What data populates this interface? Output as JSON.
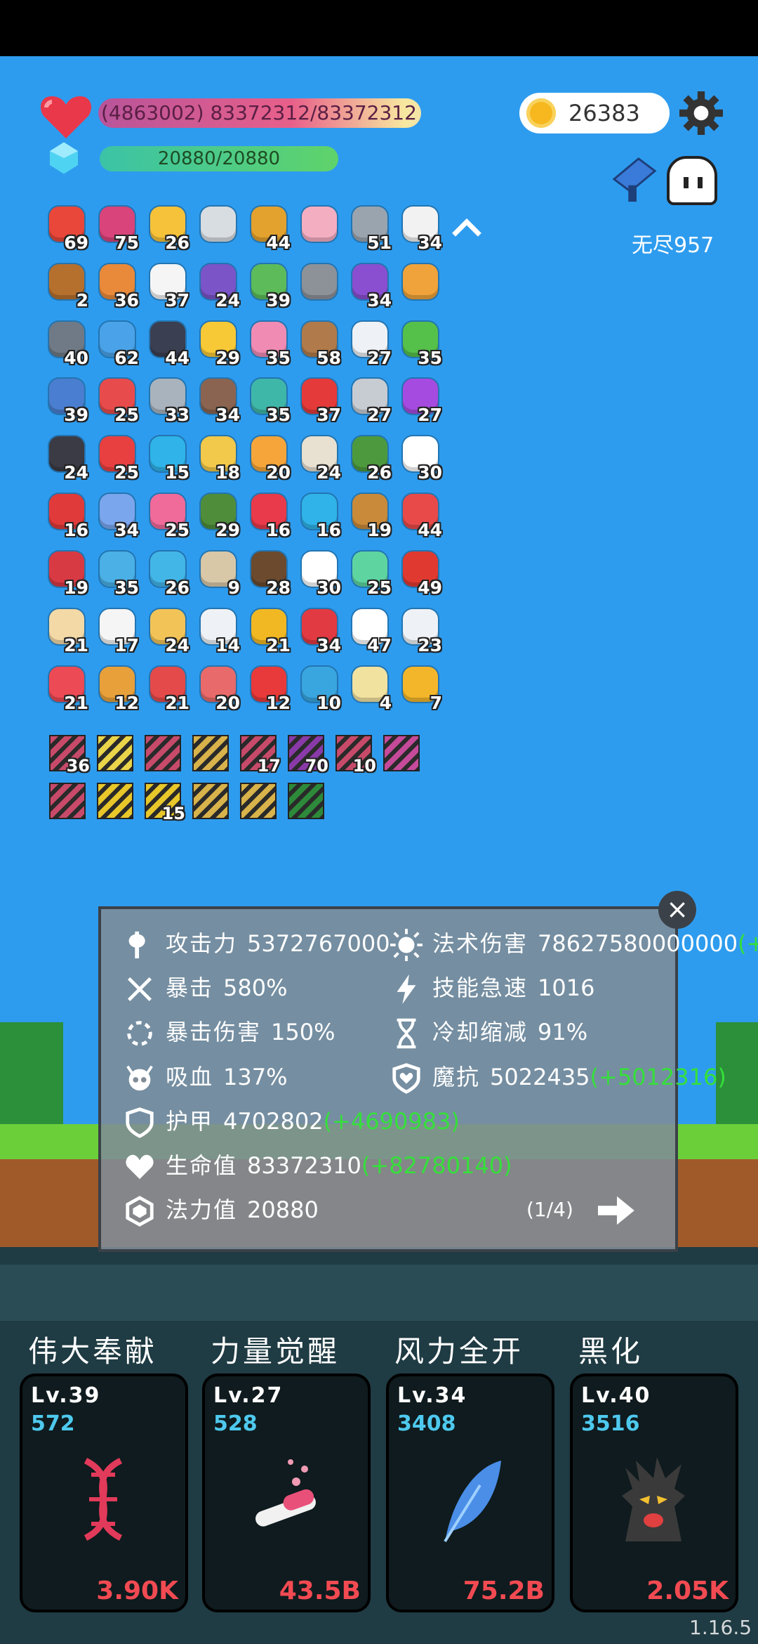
{
  "hud": {
    "hp_text": "(4863002) 83372312/83372312",
    "hp_fill_fraction": 1.0,
    "mp_text": "20880/20880",
    "mp_fill_fraction": 1.0,
    "coins": "26383",
    "mode_label": "无尽957"
  },
  "inventory": {
    "rows": [
      [
        {
          "icon": "watermelon-icon",
          "count": "69",
          "color": "#e8473a"
        },
        {
          "icon": "jam-jar-icon",
          "count": "75",
          "color": "#d9447a"
        },
        {
          "icon": "sun-icon",
          "count": "26",
          "color": "#f6c23a"
        },
        {
          "icon": "sword-icon",
          "count": "",
          "color": "#d8dde2"
        },
        {
          "icon": "book-icon",
          "count": "44",
          "color": "#e3a12e"
        },
        {
          "icon": "love-letter-icon",
          "count": "",
          "color": "#f4aec2"
        },
        {
          "icon": "broadsword-icon",
          "count": "51",
          "color": "#9aa4ae"
        },
        {
          "icon": "dice-icon",
          "count": "34",
          "color": "#f2f2f2"
        }
      ],
      [
        {
          "icon": "drumstick-icon",
          "count": "2",
          "color": "#b5702e"
        },
        {
          "icon": "meteor-icon",
          "count": "36",
          "color": "#e98a3a"
        },
        {
          "icon": "playing-cards-icon",
          "count": "37",
          "color": "#f5f5f5"
        },
        {
          "icon": "star-shield-icon",
          "count": "24",
          "color": "#7b54c8"
        },
        {
          "icon": "money-heart-icon",
          "count": "39",
          "color": "#5dbb5a"
        },
        {
          "icon": "knight-helmet-icon",
          "count": "",
          "color": "#8d9299"
        },
        {
          "icon": "purple-hat-icon",
          "count": "34",
          "color": "#8a4fd0"
        },
        {
          "icon": "ticket-icon",
          "count": "",
          "color": "#f0a33a"
        }
      ],
      [
        {
          "icon": "spiked-ball-icon",
          "count": "40",
          "color": "#6f7a86"
        },
        {
          "icon": "star-card-icon",
          "count": "62",
          "color": "#4aa3e8"
        },
        {
          "icon": "bat-icon",
          "count": "44",
          "color": "#3b3f52"
        },
        {
          "icon": "crown-icon",
          "count": "29",
          "color": "#f7c936"
        },
        {
          "icon": "ice-cream-icon",
          "count": "35",
          "color": "#f08cb4"
        },
        {
          "icon": "donut-shield-icon",
          "count": "58",
          "color": "#b07a4a"
        },
        {
          "icon": "cloud-icon",
          "count": "27",
          "color": "#eef2f6"
        },
        {
          "icon": "green-slime-icon",
          "count": "35",
          "color": "#55c04a"
        }
      ],
      [
        {
          "icon": "blue-shield-icon",
          "count": "39",
          "color": "#4a7ed0"
        },
        {
          "icon": "pill-icon",
          "count": "25",
          "color": "#e84b4b"
        },
        {
          "icon": "battle-axe-icon",
          "count": "33",
          "color": "#a9b3bd"
        },
        {
          "icon": "helmet-icon",
          "count": "34",
          "color": "#8a6450"
        },
        {
          "icon": "ring-target-icon",
          "count": "35",
          "color": "#3fb7a8"
        },
        {
          "icon": "mushroom-icon",
          "count": "37",
          "color": "#e53a3a"
        },
        {
          "icon": "compass-icon",
          "count": "27",
          "color": "#c7ccd2"
        },
        {
          "icon": "magic-orb-icon",
          "count": "27",
          "color": "#a64be0"
        }
      ],
      [
        {
          "icon": "cauldron-icon",
          "count": "24",
          "color": "#3b3b45"
        },
        {
          "icon": "gift-box-icon",
          "count": "25",
          "color": "#e84040"
        },
        {
          "icon": "blue-gem-icon",
          "count": "15",
          "color": "#2fb3e8"
        },
        {
          "icon": "diamond-ring-icon",
          "count": "18",
          "color": "#f2c94a"
        },
        {
          "icon": "magic-wand-icon",
          "count": "20",
          "color": "#f6a53a"
        },
        {
          "icon": "flag-cake-icon",
          "count": "24",
          "color": "#e8e0d0"
        },
        {
          "icon": "green-helmet-icon",
          "count": "26",
          "color": "#4d9a3e"
        },
        {
          "icon": "ghost-icon",
          "count": "30",
          "color": "#ffffff"
        }
      ],
      [
        {
          "icon": "rose-icon",
          "count": "16",
          "color": "#e03a3a"
        },
        {
          "icon": "capsule-icon",
          "count": "34",
          "color": "#7aa6ee"
        },
        {
          "icon": "potion-bottle-icon",
          "count": "25",
          "color": "#f06a9a"
        },
        {
          "icon": "grenade-icon",
          "count": "29",
          "color": "#4f8d3a"
        },
        {
          "icon": "broken-heart-icon",
          "count": "16",
          "color": "#e83a4a"
        },
        {
          "icon": "crosshair-icon",
          "count": "16",
          "color": "#2fb3e8"
        },
        {
          "icon": "bow-icon",
          "count": "19",
          "color": "#c98a3a"
        },
        {
          "icon": "sock-icon",
          "count": "44",
          "color": "#e84a4a"
        }
      ],
      [
        {
          "icon": "red-shield-icon",
          "count": "19",
          "color": "#d83a44"
        },
        {
          "icon": "blue-bomb-icon",
          "count": "35",
          "color": "#4ab0e6"
        },
        {
          "icon": "chat-bubble-icon",
          "count": "26",
          "color": "#43b6e8"
        },
        {
          "icon": "noose-icon",
          "count": "9",
          "color": "#d8c8a8"
        },
        {
          "icon": "coconut-icon",
          "count": "28",
          "color": "#6b4a2e"
        },
        {
          "icon": "fried-egg-icon",
          "count": "30",
          "color": "#ffffff"
        },
        {
          "icon": "green-spirit-icon",
          "count": "25",
          "color": "#5ed5a0"
        },
        {
          "icon": "apple-icon",
          "count": "49",
          "color": "#e03a30"
        }
      ],
      [
        {
          "icon": "hand-icon",
          "count": "21",
          "color": "#f3d9a6"
        },
        {
          "icon": "clipboard-icon",
          "count": "17",
          "color": "#f5f5f5"
        },
        {
          "icon": "folded-map-icon",
          "count": "24",
          "color": "#f2c458"
        },
        {
          "icon": "light-bulb-icon",
          "count": "14",
          "color": "#eef2f6"
        },
        {
          "icon": "sunflower-icon",
          "count": "21",
          "color": "#f2b824"
        },
        {
          "icon": "strawberry-icon",
          "count": "34",
          "color": "#e23a42"
        },
        {
          "icon": "daisy-icon",
          "count": "47",
          "color": "#ffffff"
        },
        {
          "icon": "envelope-icon",
          "count": "23",
          "color": "#eef2f6"
        }
      ],
      [
        {
          "icon": "heart-icon",
          "count": "21",
          "color": "#ec4a55"
        },
        {
          "icon": "scroll-icon",
          "count": "12",
          "color": "#e8a03a"
        },
        {
          "icon": "thermometer-icon",
          "count": "21",
          "color": "#e44a4a"
        },
        {
          "icon": "meat-icon",
          "count": "20",
          "color": "#e86a6a"
        },
        {
          "icon": "bookmark-icon",
          "count": "12",
          "color": "#e83a3a"
        },
        {
          "icon": "blue-scroll-icon",
          "count": "10",
          "color": "#3aa6e0"
        },
        {
          "icon": "halo-icon",
          "count": "4",
          "color": "#f2e2a0"
        },
        {
          "icon": "coin-stack-icon",
          "count": "7",
          "color": "#f3b62a"
        }
      ]
    ],
    "equipment": [
      [
        {
          "icon": "striped-card-icon",
          "count": "36",
          "color": "#c84a6a"
        },
        {
          "icon": "glow-card-icon",
          "count": "",
          "color": "#e9d44a"
        },
        {
          "icon": "striped-card-icon",
          "count": "",
          "color": "#c84a6a"
        },
        {
          "icon": "gold-box-icon",
          "count": "",
          "color": "#d8b24a"
        },
        {
          "icon": "striped-card-icon",
          "count": "17",
          "color": "#c84a6a"
        },
        {
          "icon": "purple-rune-icon",
          "count": "70",
          "color": "#8a3aa8"
        },
        {
          "icon": "striped-card-icon",
          "count": "10",
          "color": "#c84a6a"
        },
        {
          "icon": "pink-rune-icon",
          "count": "",
          "color": "#c64a9a"
        }
      ],
      [
        {
          "icon": "striped-card-icon",
          "count": "",
          "color": "#c84a6a"
        },
        {
          "icon": "yellow-face-icon",
          "count": "",
          "color": "#e8c72a"
        },
        {
          "icon": "yellow-face-icon",
          "count": "15",
          "color": "#e8c72a"
        },
        {
          "icon": "gold-box-icon",
          "count": "",
          "color": "#d8b24a"
        },
        {
          "icon": "gold-box-icon",
          "count": "",
          "color": "#d8b24a"
        },
        {
          "icon": "green-rune-icon",
          "count": "",
          "color": "#2d8a3a"
        }
      ]
    ]
  },
  "stats": {
    "left": [
      {
        "icon": "axe-icon",
        "name": "攻击力",
        "value": "5372767000",
        "bonus": ""
      },
      {
        "icon": "crit-icon",
        "name": "暴击",
        "value": "580%",
        "bonus": ""
      },
      {
        "icon": "crit-damage-icon",
        "name": "暴击伤害",
        "value": "150%",
        "bonus": ""
      },
      {
        "icon": "skull-icon",
        "name": "吸血",
        "value": "137%",
        "bonus": ""
      },
      {
        "icon": "armor-shield-icon",
        "name": "护甲",
        "value": "4702802",
        "bonus": "(+4690983)"
      },
      {
        "icon": "heart-icon",
        "name": "生命值",
        "value": "83372310",
        "bonus": "(+82780140)"
      },
      {
        "icon": "mana-crystal-icon",
        "name": "法力值",
        "value": "20880",
        "bonus": ""
      }
    ],
    "right": [
      {
        "icon": "sun-icon",
        "name": "法术伤害",
        "value": "78627580000000",
        "bonus": "(+"
      },
      {
        "icon": "lightning-icon",
        "name": "技能急速",
        "value": "1016",
        "bonus": ""
      },
      {
        "icon": "hourglass-icon",
        "name": "冷却缩减",
        "value": "91%",
        "bonus": ""
      },
      {
        "icon": "magic-shield-icon",
        "name": "魔抗",
        "value": "5022435",
        "bonus": "(+5012316)"
      }
    ],
    "page": "(1/4)"
  },
  "skills": [
    {
      "title": "伟大奉献",
      "level": "Lv.39",
      "points": "572",
      "cost": "3.90K",
      "icon": "dna-icon",
      "color": "#e23a5a"
    },
    {
      "title": "力量觉醒",
      "level": "Lv.27",
      "points": "528",
      "cost": "43.5B",
      "icon": "test-tube-icon",
      "color": "#e8507a"
    },
    {
      "title": "风力全开",
      "level": "Lv.34",
      "points": "3408",
      "cost": "75.2B",
      "icon": "feather-icon",
      "color": "#4a8ee8"
    },
    {
      "title": "黑化",
      "level": "Lv.40",
      "points": "3516",
      "cost": "2.05K",
      "icon": "evil-tree-icon",
      "color": "#3a3a3a"
    }
  ],
  "version": "1.16.5"
}
